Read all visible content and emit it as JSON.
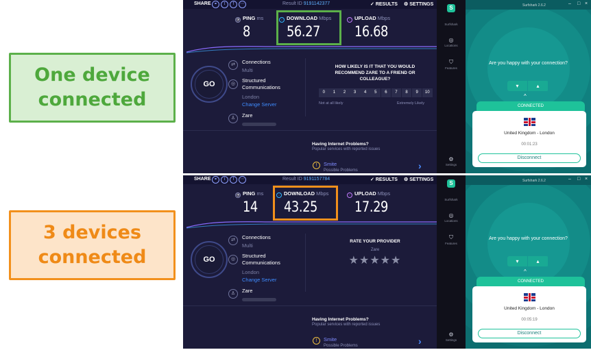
{
  "labels": {
    "one": "One device connected",
    "three": "3 devices connected"
  },
  "colors": {
    "green_highlight": "#5cb04a",
    "orange_highlight": "#f2901c",
    "surfshark_accent": "#1ec29a"
  },
  "panels": [
    {
      "topbar": {
        "share": "SHARE",
        "result_label": "Result ID",
        "result_id": "9191142377",
        "results": "RESULTS",
        "settings": "SETTINGS"
      },
      "ping": {
        "label": "PING",
        "unit": "ms",
        "value": "8"
      },
      "download": {
        "label": "DOWNLOAD",
        "unit": "Mbps",
        "value": "56.27"
      },
      "upload": {
        "label": "UPLOAD",
        "unit": "Mbps",
        "value": "16.68"
      },
      "go": "GO",
      "connections": {
        "title": "Connections",
        "value": "Multi"
      },
      "server": {
        "title1": "Structured",
        "title2": "Communications",
        "city": "London",
        "change": "Change Server"
      },
      "user": {
        "name": "Zare"
      },
      "survey": {
        "question": "HOW LIKELY IS IT THAT YOU WOULD RECOMMEND ZARE TO A FRIEND OR COLLEAGUE?",
        "scale": [
          "0",
          "1",
          "2",
          "3",
          "4",
          "5",
          "6",
          "7",
          "8",
          "9",
          "10"
        ],
        "low": "Not at all likely",
        "high": "Extremely Likely"
      },
      "problems": {
        "title": "Having Internet Problems?",
        "sub": "Popular services with reported issues"
      },
      "service": {
        "name": "Smite",
        "status": "Possible Problems"
      },
      "vpn": {
        "title": "Surfshark 2.6.2",
        "sidebar": [
          "Surfshark",
          "Locations",
          "Features",
          "Settings"
        ],
        "question": "Are you happy with your connection?",
        "status": "CONNECTED",
        "location": "United Kingdom - London",
        "time": "00:01:23",
        "disconnect": "Disconnect"
      }
    },
    {
      "topbar": {
        "share": "SHARE",
        "result_label": "Result ID",
        "result_id": "9191157784",
        "results": "RESULTS",
        "settings": "SETTINGS"
      },
      "ping": {
        "label": "PING",
        "unit": "ms",
        "value": "14"
      },
      "download": {
        "label": "DOWNLOAD",
        "unit": "Mbps",
        "value": "43.25"
      },
      "upload": {
        "label": "UPLOAD",
        "unit": "Mbps",
        "value": "17.29"
      },
      "go": "GO",
      "connections": {
        "title": "Connections",
        "value": "Multi"
      },
      "server": {
        "title1": "Structured",
        "title2": "Communications",
        "city": "London",
        "change": "Change Server"
      },
      "user": {
        "name": "Zare"
      },
      "rate": {
        "title": "RATE YOUR PROVIDER",
        "provider": "Zare",
        "stars": 0
      },
      "problems": {
        "title": "Having Internet Problems?",
        "sub": "Popular services with reported issues"
      },
      "service": {
        "name": "Smite",
        "status": "Possible Problems"
      },
      "vpn": {
        "title": "Surfshark 2.6.2",
        "sidebar": [
          "Surfshark",
          "Locations",
          "Features",
          "Settings"
        ],
        "question": "Are you happy with your connection?",
        "status": "CONNECTED",
        "location": "United Kingdom - London",
        "time": "00:05:19",
        "disconnect": "Disconnect"
      }
    }
  ]
}
